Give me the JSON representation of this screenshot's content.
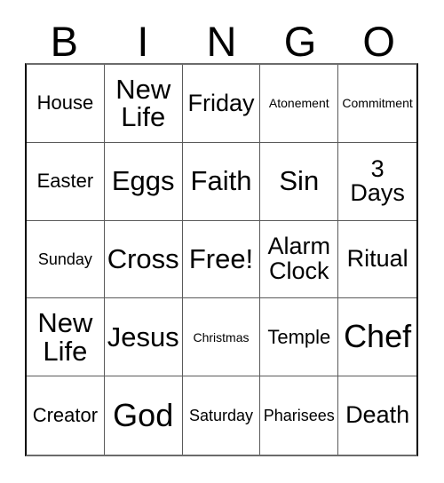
{
  "card": {
    "header": {
      "letters": [
        "B",
        "I",
        "N",
        "G",
        "O"
      ]
    },
    "grid": {
      "rows": 5,
      "columns": 5,
      "cells": [
        {
          "text": "House",
          "size": "fs-m"
        },
        {
          "text": "New\nLife",
          "size": "fs-xl"
        },
        {
          "text": "Friday",
          "size": "fs-l"
        },
        {
          "text": "Atonement",
          "size": "fs-xs"
        },
        {
          "text": "Commitment",
          "size": "fs-xs"
        },
        {
          "text": "Easter",
          "size": "fs-m"
        },
        {
          "text": "Eggs",
          "size": "fs-xl"
        },
        {
          "text": "Faith",
          "size": "fs-xl"
        },
        {
          "text": "Sin",
          "size": "fs-xl"
        },
        {
          "text": "3\nDays",
          "size": "fs-l"
        },
        {
          "text": "Sunday",
          "size": "fs-s"
        },
        {
          "text": "Cross",
          "size": "fs-xl"
        },
        {
          "text": "Free!",
          "size": "fs-xl"
        },
        {
          "text": "Alarm\nClock",
          "size": "fs-l"
        },
        {
          "text": "Ritual",
          "size": "fs-l"
        },
        {
          "text": "New\nLife",
          "size": "fs-xl"
        },
        {
          "text": "Jesus",
          "size": "fs-xl"
        },
        {
          "text": "Christmas",
          "size": "fs-xs"
        },
        {
          "text": "Temple",
          "size": "fs-m"
        },
        {
          "text": "Chef",
          "size": "fs-xxl"
        },
        {
          "text": "Creator",
          "size": "fs-m"
        },
        {
          "text": "God",
          "size": "fs-xxl"
        },
        {
          "text": "Saturday",
          "size": "fs-s"
        },
        {
          "text": "Pharisees",
          "size": "fs-s"
        },
        {
          "text": "Death",
          "size": "fs-l"
        }
      ]
    },
    "colors": {
      "background": "#ffffff",
      "text": "#000000",
      "grid_line": "#5a5a5a",
      "outer_border": "#000000"
    }
  }
}
